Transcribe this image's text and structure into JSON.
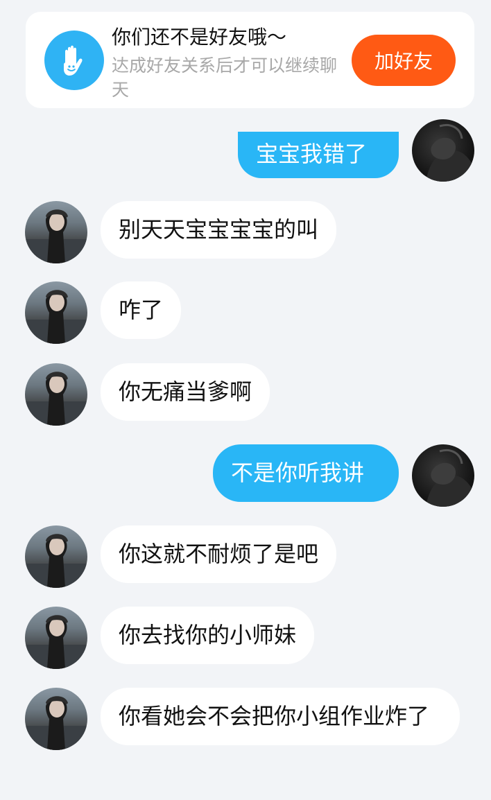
{
  "banner": {
    "title": "你们还不是好友哦～",
    "subtitle": "达成好友关系后才可以继续聊天",
    "add_friend_label": "加好友"
  },
  "messages": [
    {
      "side": "right",
      "text": "宝宝我错了"
    },
    {
      "side": "left",
      "text": "别天天宝宝宝宝的叫"
    },
    {
      "side": "left",
      "text": "咋了"
    },
    {
      "side": "left",
      "text": "你无痛当爹啊"
    },
    {
      "side": "right",
      "text": "不是你听我讲"
    },
    {
      "side": "left",
      "text": "你这就不耐烦了是吧"
    },
    {
      "side": "left",
      "text": "你去找你的小师妹"
    },
    {
      "side": "left",
      "text": "你看她会不会把你小组作业炸了"
    }
  ],
  "colors": {
    "background": "#f2f4f7",
    "outgoing_bubble": "#29b6f6",
    "incoming_bubble": "#ffffff",
    "add_friend_button": "#ff5a14",
    "banner_icon": "#2fb3f4"
  }
}
